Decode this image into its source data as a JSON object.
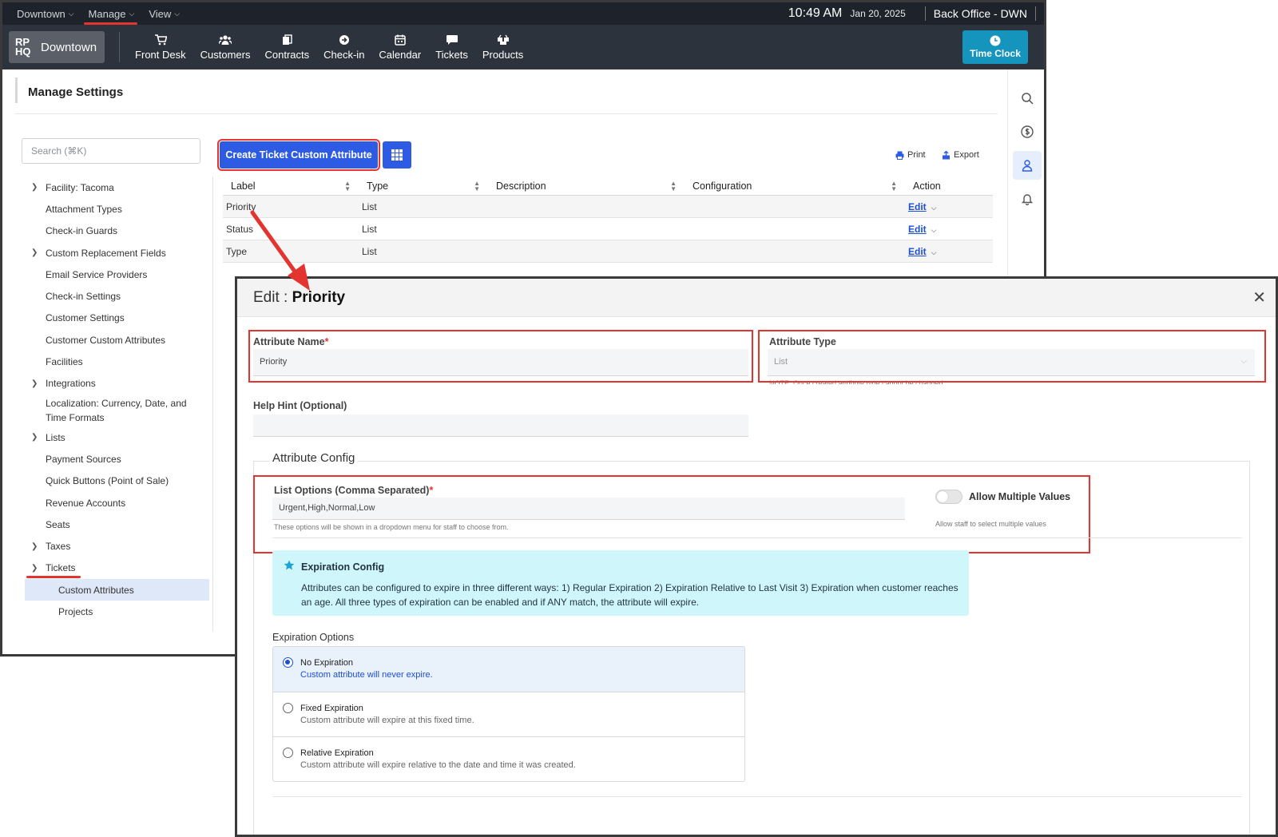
{
  "topbar": {
    "menus": [
      {
        "label": "Downtown"
      },
      {
        "label": "Manage"
      },
      {
        "label": "View"
      }
    ],
    "time": "10:49 AM",
    "date": "Jan 20, 2025",
    "office": "Back Office - DWN"
  },
  "navbar": {
    "brand_logo": "RP HQ",
    "brand_name": "Downtown",
    "items": [
      {
        "label": "Front Desk",
        "icon": "cart-icon"
      },
      {
        "label": "Customers",
        "icon": "users-icon"
      },
      {
        "label": "Contracts",
        "icon": "contracts-icon"
      },
      {
        "label": "Check-in",
        "icon": "arrow-circle-icon"
      },
      {
        "label": "Calendar",
        "icon": "calendar-icon"
      },
      {
        "label": "Tickets",
        "icon": "chat-icon"
      },
      {
        "label": "Products",
        "icon": "boxes-icon"
      }
    ],
    "time_clock": "Time Clock"
  },
  "page": {
    "title": "Manage Settings",
    "search_placeholder": "Search (⌘K)"
  },
  "sidebar": {
    "items": [
      {
        "label": "Facility: Tacoma"
      },
      {
        "label": "Attachment Types"
      },
      {
        "label": "Check-in Guards"
      },
      {
        "label": "Custom Replacement Fields"
      },
      {
        "label": "Email Service Providers"
      },
      {
        "label": "Check-in Settings"
      },
      {
        "label": "Customer Settings"
      },
      {
        "label": "Customer Custom Attributes"
      },
      {
        "label": "Facilities"
      },
      {
        "label": "Integrations"
      },
      {
        "label": "Localization: Currency, Date, and Time Formats"
      },
      {
        "label": "Lists"
      },
      {
        "label": "Payment Sources"
      },
      {
        "label": "Quick Buttons (Point of Sale)"
      },
      {
        "label": "Revenue Accounts"
      },
      {
        "label": "Seats"
      },
      {
        "label": "Taxes"
      },
      {
        "label": "Tickets"
      },
      {
        "label": "Custom Attributes"
      },
      {
        "label": "Projects"
      }
    ]
  },
  "toolbar": {
    "create_label": "Create Ticket Custom Attribute",
    "print_label": "Print",
    "export_label": "Export"
  },
  "table": {
    "columns": [
      "Label",
      "Type",
      "Description",
      "Configuration",
      "Action"
    ],
    "rows": [
      {
        "label": "Priority",
        "type": "List",
        "action": "Edit"
      },
      {
        "label": "Status",
        "type": "List",
        "action": "Edit"
      },
      {
        "label": "Type",
        "type": "List",
        "action": "Edit"
      }
    ]
  },
  "modal": {
    "title_prefix": "Edit :",
    "title_name": "Priority",
    "attribute_name_label": "Attribute Name",
    "attribute_name_value": "Priority",
    "attribute_type_label": "Attribute Type",
    "attribute_type_value": "List",
    "attribute_type_note": "NOTE: Once created attribute type cannot be changed",
    "help_hint_label": "Help Hint (Optional)",
    "attribute_config_legend": "Attribute Config",
    "list_options_label": "List Options (Comma Separated)",
    "list_options_value": "Urgent,High,Normal,Low",
    "list_options_help": "These options will be shown in a dropdown menu for staff to choose from.",
    "allow_multiple_label": "Allow Multiple Values",
    "allow_multiple_help": "Allow staff to select multiple values",
    "allow_multiple_on": false,
    "expiration_title": "Expiration Config",
    "expiration_text": "Attributes can be configured to expire in three different ways: 1) Regular Expiration 2) Expiration Relative to Last Visit 3) Expiration when customer reaches an age. All three types of expiration can be enabled and if ANY match, the attribute will expire.",
    "expiration_options_label": "Expiration Options",
    "expiration_options": [
      {
        "title": "No Expiration",
        "desc": "Custom attribute will never expire.",
        "selected": true
      },
      {
        "title": "Fixed Expiration",
        "desc": "Custom attribute will expire at this fixed time.",
        "selected": false
      },
      {
        "title": "Relative Expiration",
        "desc": "Custom attribute will expire relative to the date and time it was created.",
        "selected": false
      }
    ]
  },
  "colors": {
    "accent": "#2d5be3",
    "highlight_red": "#e3342f",
    "alert_bg": "#cff7fb",
    "time_clock": "#1594bd"
  }
}
